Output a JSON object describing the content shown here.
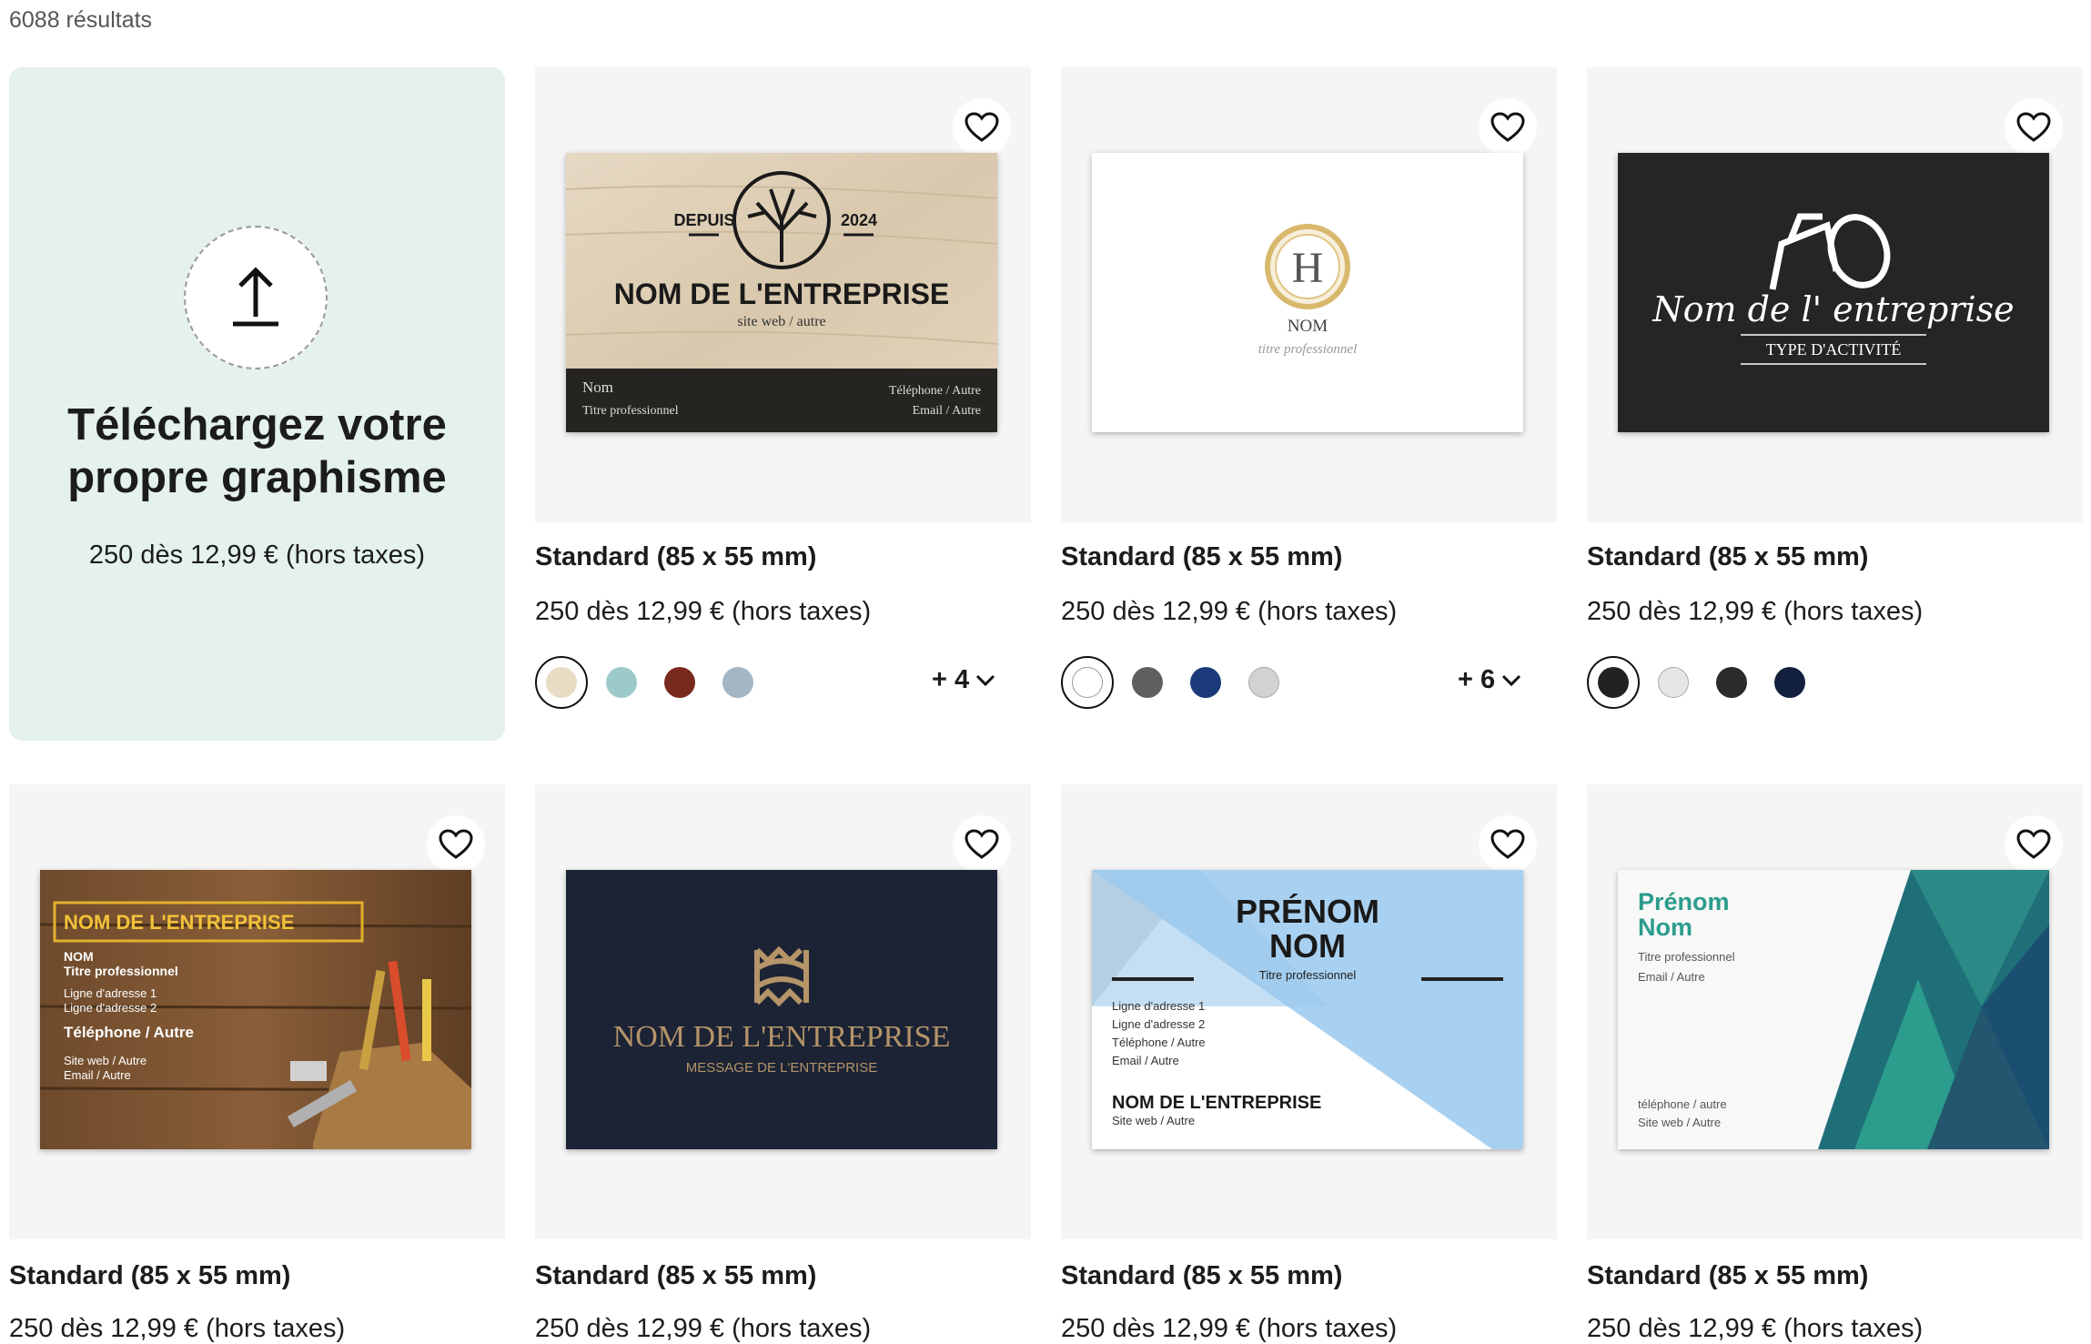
{
  "results_count": "6088 résultats",
  "upload": {
    "title": "Téléchargez votre propre graphisme",
    "price": "250 dès 12,99 € (hors taxes)"
  },
  "products": [
    {
      "title": "Standard (85 x 55 mm)",
      "price": "250 dès 12,99 € (hors taxes)",
      "swatches": [
        "#e8dcc4",
        "#9ccac9",
        "#7a2a1d",
        "#a4b5c3"
      ],
      "more": "+ 4",
      "card": {
        "depuis": "DEPUIS",
        "year": "2024",
        "company": "NOM DE L'ENTREPRISE",
        "web": "site web / autre",
        "name": "Nom",
        "job": "Titre professionnel",
        "phone": "Téléphone / Autre",
        "email": "Email / Autre"
      }
    },
    {
      "title": "Standard (85 x 55 mm)",
      "price": "250 dès 12,99 € (hors taxes)",
      "swatches": [
        "#ffffff",
        "#5f5f5f",
        "#1b3a7a",
        "#d2d2d2"
      ],
      "more": "+ 6",
      "card": {
        "initial": "H",
        "name": "NOM",
        "job": "titre professionnel"
      }
    },
    {
      "title": "Standard (85 x 55 mm)",
      "price": "250 dès 12,99 € (hors taxes)",
      "swatches": [
        "#222222",
        "#e6e6e6",
        "#2b2b2b",
        "#13203d"
      ],
      "more": "",
      "card": {
        "company": "Nom de l' entreprise",
        "activity": "TYPE D'ACTIVITÉ"
      }
    },
    {
      "title": "Standard (85 x 55 mm)",
      "price": "250 dès 12,99 € (hors taxes)",
      "card": {
        "company": "NOM DE L'ENTREPRISE",
        "name": "NOM",
        "job": "Titre professionnel",
        "addr1": "Ligne d'adresse 1",
        "addr2": "Ligne d'adresse 2",
        "phone": "Téléphone / Autre",
        "web": "Site web / Autre",
        "email": "Email / Autre"
      }
    },
    {
      "title": "Standard (85 x 55 mm)",
      "price": "250 dès 12,99 € (hors taxes)",
      "card": {
        "company": "NOM DE L'ENTREPRISE",
        "message": "MESSAGE DE L'ENTREPRISE"
      }
    },
    {
      "title": "Standard (85 x 55 mm)",
      "price": "250 dès 12,99 € (hors taxes)",
      "card": {
        "first": "PRÉNOM",
        "last": "NOM",
        "job": "Titre professionnel",
        "addr1": "Ligne d'adresse 1",
        "addr2": "Ligne d'adresse 2",
        "phone": "Téléphone / Autre",
        "email": "Email / Autre",
        "company": "NOM DE L'ENTREPRISE",
        "web": "Site web / Autre"
      }
    },
    {
      "title": "Standard (85 x 55 mm)",
      "price": "250 dès 12,99 € (hors taxes)",
      "card": {
        "first": "Prénom",
        "last": "Nom",
        "job": "Titre professionnel",
        "email": "Email / Autre",
        "phone": "téléphone / autre",
        "web": "Site web / Autre"
      }
    }
  ]
}
